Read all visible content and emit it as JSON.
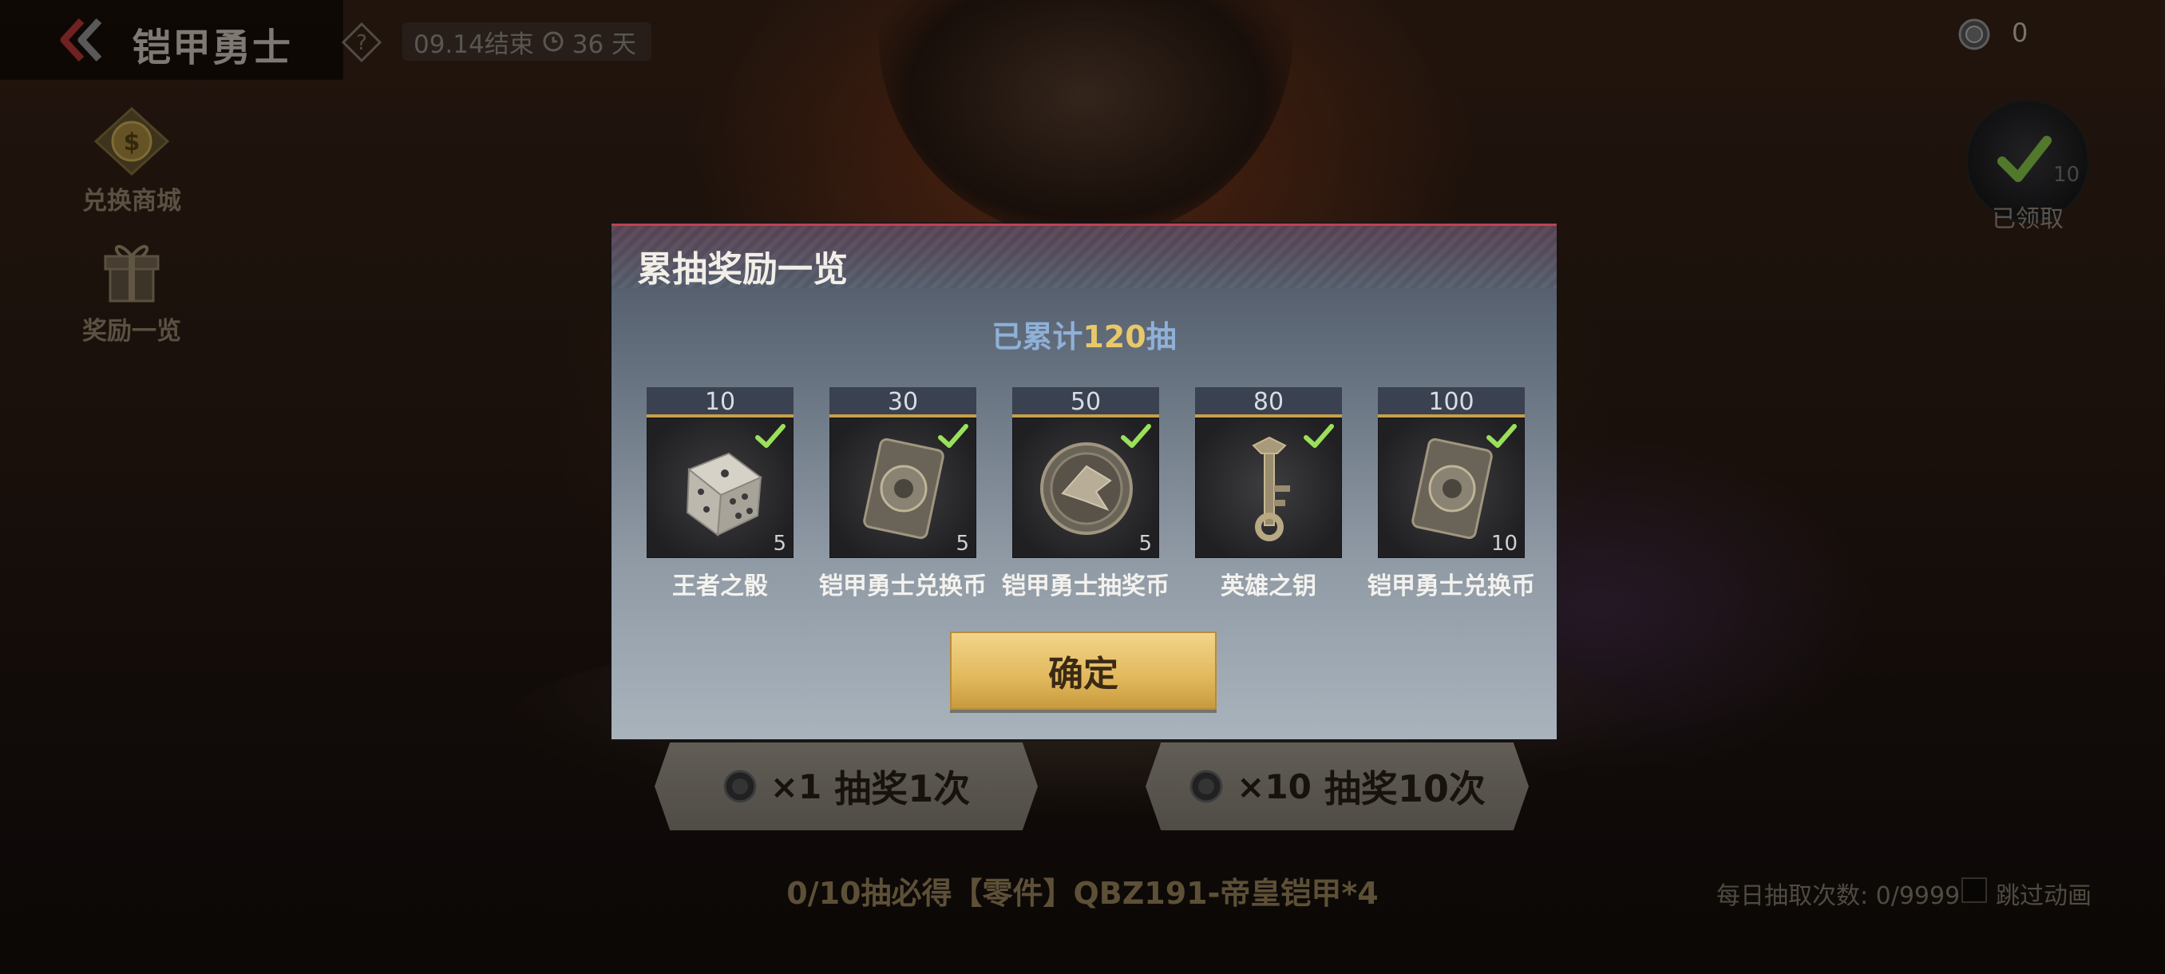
{
  "header": {
    "title": "铠甲勇士",
    "end_date": "09.14结束",
    "days_left": "36 天",
    "currency_count": "0"
  },
  "side_menu": {
    "exchange_shop": "兑换商城",
    "rewards_list": "奖励一览"
  },
  "claimed_badge": {
    "count": "10",
    "label": "已领取"
  },
  "draw_buttons": {
    "single": {
      "multiplier": "×1",
      "label": "抽奖1次"
    },
    "ten": {
      "multiplier": "×10",
      "label": "抽奖10次"
    }
  },
  "footer": {
    "guarantee": "0/10抽必得【零件】QBZ191-帝皇铠甲*4",
    "daily_draws": "每日抽取次数: 0/9999",
    "skip_animation": "跳过动画"
  },
  "modal": {
    "title": "累抽奖励一览",
    "count_prefix": "已累计",
    "count_value": "120",
    "count_suffix": "抽",
    "confirm": "确定",
    "rewards": [
      {
        "threshold": "10",
        "name": "王者之骰",
        "quantity": "5",
        "icon": "dice-icon",
        "claimed": true
      },
      {
        "threshold": "30",
        "name": "铠甲勇士兑换币",
        "quantity": "5",
        "icon": "exchange-coin-icon",
        "claimed": true
      },
      {
        "threshold": "50",
        "name": "铠甲勇士抽奖币",
        "quantity": "5",
        "icon": "lottery-coin-icon",
        "claimed": true
      },
      {
        "threshold": "80",
        "name": "英雄之钥",
        "quantity": "",
        "icon": "key-icon",
        "claimed": true
      },
      {
        "threshold": "100",
        "name": "铠甲勇士兑换币",
        "quantity": "10",
        "icon": "exchange-coin-icon",
        "claimed": true
      }
    ]
  },
  "colors": {
    "check": "#9ae05a",
    "gold": "#e8c868",
    "accent_red": "#c04050"
  }
}
